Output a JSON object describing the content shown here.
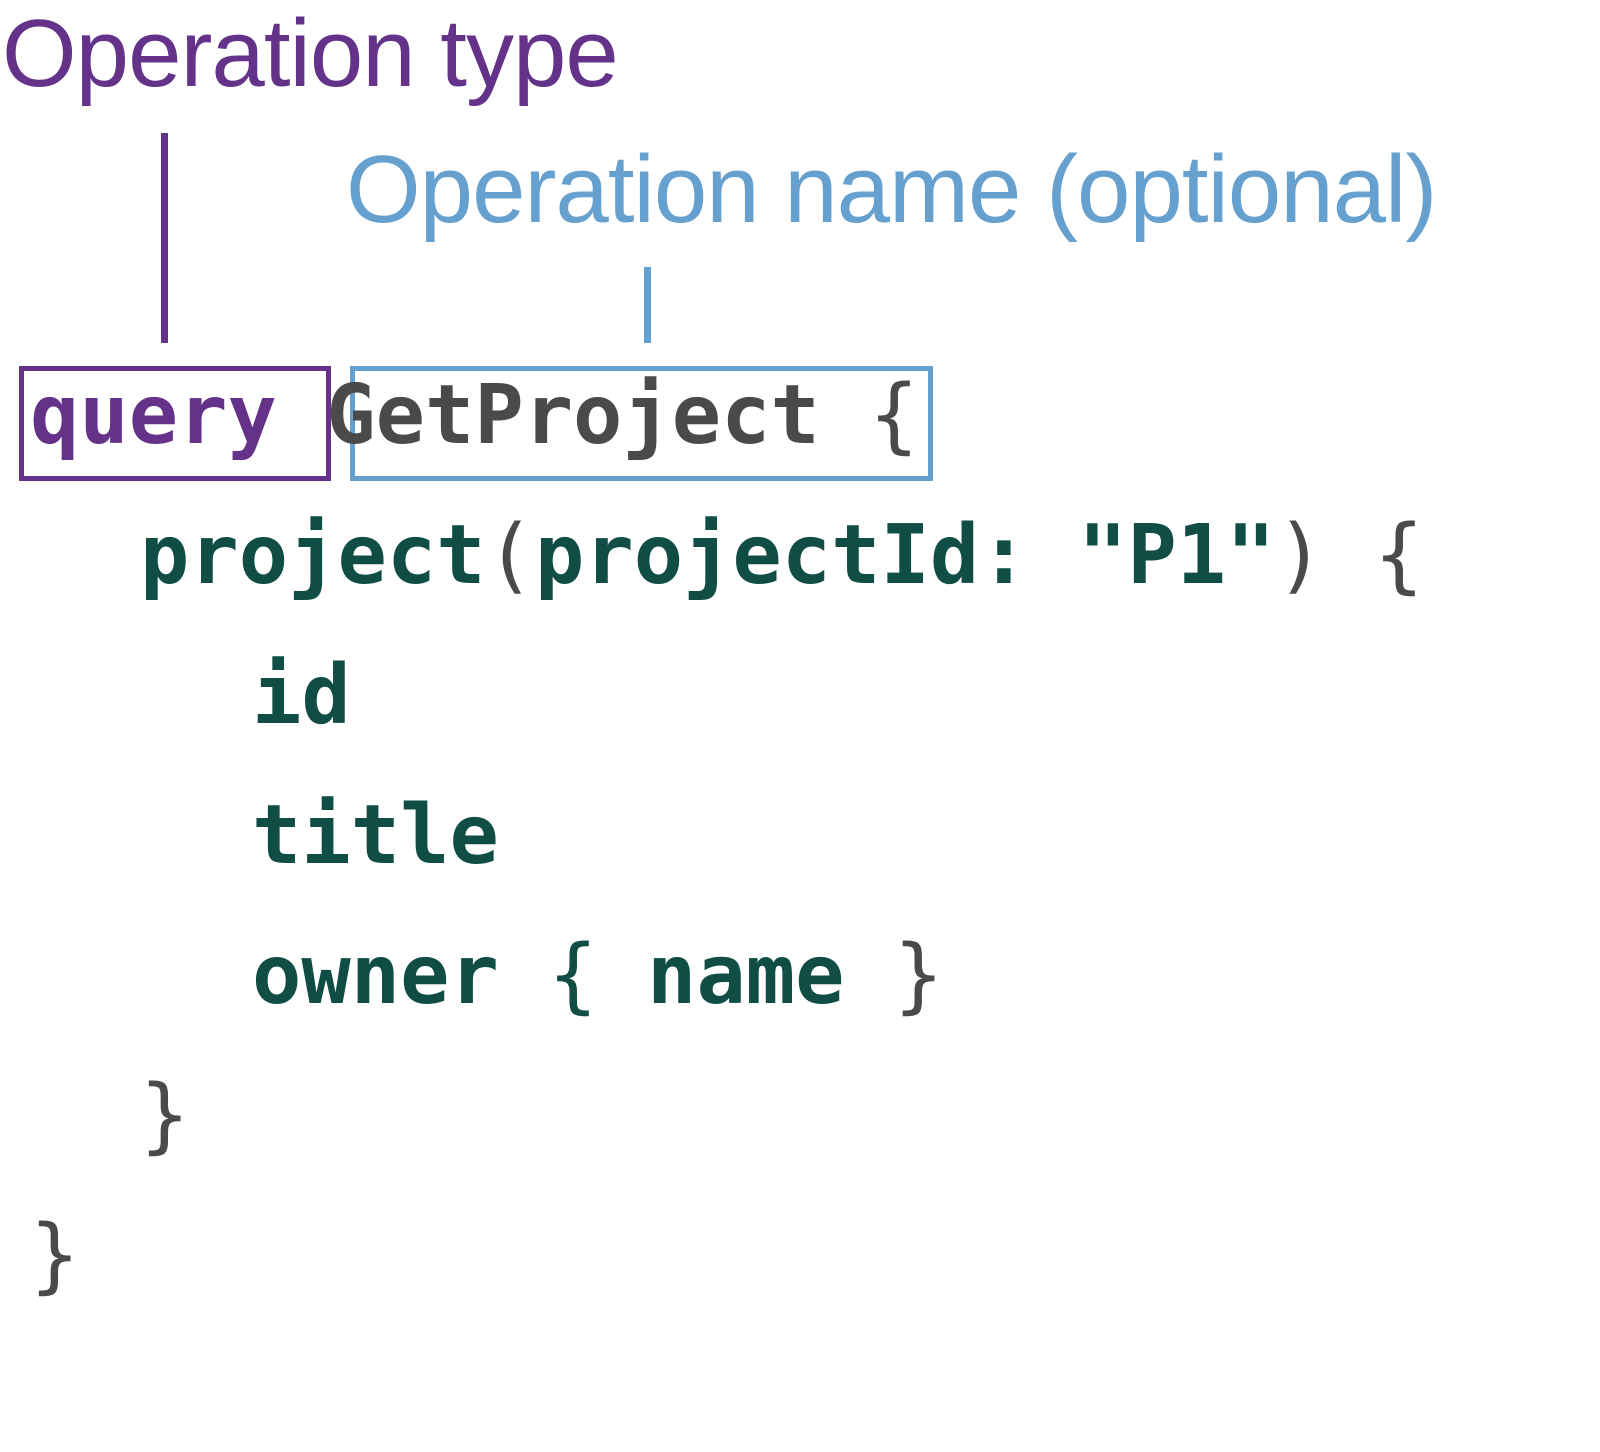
{
  "annotations": {
    "operation_type": {
      "label": "Operation type",
      "color": "#65328a"
    },
    "operation_name": {
      "label": "Operation name (optional)",
      "color": "#66a0cf"
    }
  },
  "code": {
    "keyword": "query",
    "operation_name": "GetProject",
    "open_brace": "{",
    "close_brace": "}",
    "field": "project",
    "args_open": "(",
    "arg_name": "projectId",
    "arg_colon": ":",
    "arg_value": "\"P1\"",
    "args_close": ")",
    "fields": [
      "id",
      "title",
      "owner"
    ],
    "subfield": "name"
  },
  "colors": {
    "keyword": "#65328a",
    "operation_name": "#4a4a4a",
    "field": "#0f4d45",
    "punctuation": "#4a4a4a",
    "background": "#ffffff"
  }
}
